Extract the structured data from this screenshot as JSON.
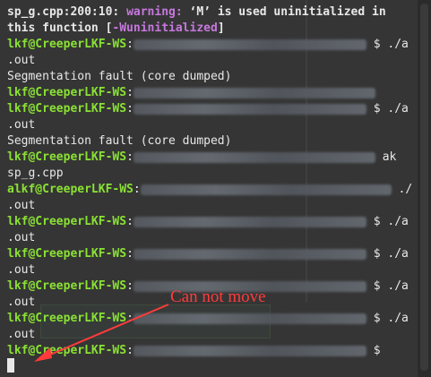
{
  "terminal": {
    "warning": {
      "location": "sp_g.cpp:200:10:",
      "level": "warning:",
      "message_a": " ‘M’ is used uninitialized in",
      "message_b": "this function [",
      "flag": "-Wuninitialized",
      "message_c": "]"
    },
    "prompt_user": "lkf@CreeperLKF-WS",
    "prompt_user_alt": "alkf@CreeperLKF-WS",
    "prompt_sep": ":",
    "cmd_run": "$ ./a",
    "cmd_run_tail": ".out",
    "cmd_path_tail": "ak",
    "cmd_path_tail2": "sp_g.cpp",
    "cmd_run2": "./",
    "segfault": "Segmentation fault (core dumped)",
    "prompt_dollar": "$",
    "last_tail": "$"
  },
  "annotation": {
    "text": "Can not move",
    "color": "#ff3b3b"
  },
  "colors": {
    "background": "#353535",
    "text": "#e8e8e8",
    "user": "#8ae234",
    "warning": "#c678dd"
  }
}
